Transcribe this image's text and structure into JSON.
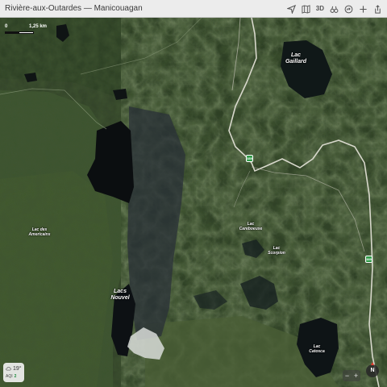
{
  "window": {
    "title": "Rivière-aux-Outardes — Manicouagan"
  },
  "toolbar": {
    "icons": [
      "location-arrow-icon",
      "map-icon",
      "3d-button",
      "binoculars-icon",
      "directions-icon",
      "add-icon",
      "share-icon"
    ],
    "three_d_label": "3D"
  },
  "scale": {
    "zero": "0",
    "distance": "1,25 km"
  },
  "places": {
    "lac_gaillard": [
      "Lac",
      "Gaillard"
    ],
    "lac_des_americains": [
      "Lac des",
      "Americains"
    ],
    "lac_careboeuse": [
      "Lac",
      "Careboeuse"
    ],
    "lac_scorpion": [
      "Lac",
      "Scorpion"
    ],
    "lacs_nouvel": [
      "Lacs",
      "Nouvel"
    ],
    "lac_catosca": [
      "Lac",
      "Catosca"
    ]
  },
  "roads": {
    "shield_label": "389",
    "shield_color": "#2e9a46"
  },
  "weather": {
    "icon": "cloud-icon",
    "temperature": "19°",
    "aqi_label": "AQI",
    "aqi_value": "2"
  },
  "controls": {
    "zoom_out": "−",
    "zoom_in": "+",
    "compass": "N"
  }
}
